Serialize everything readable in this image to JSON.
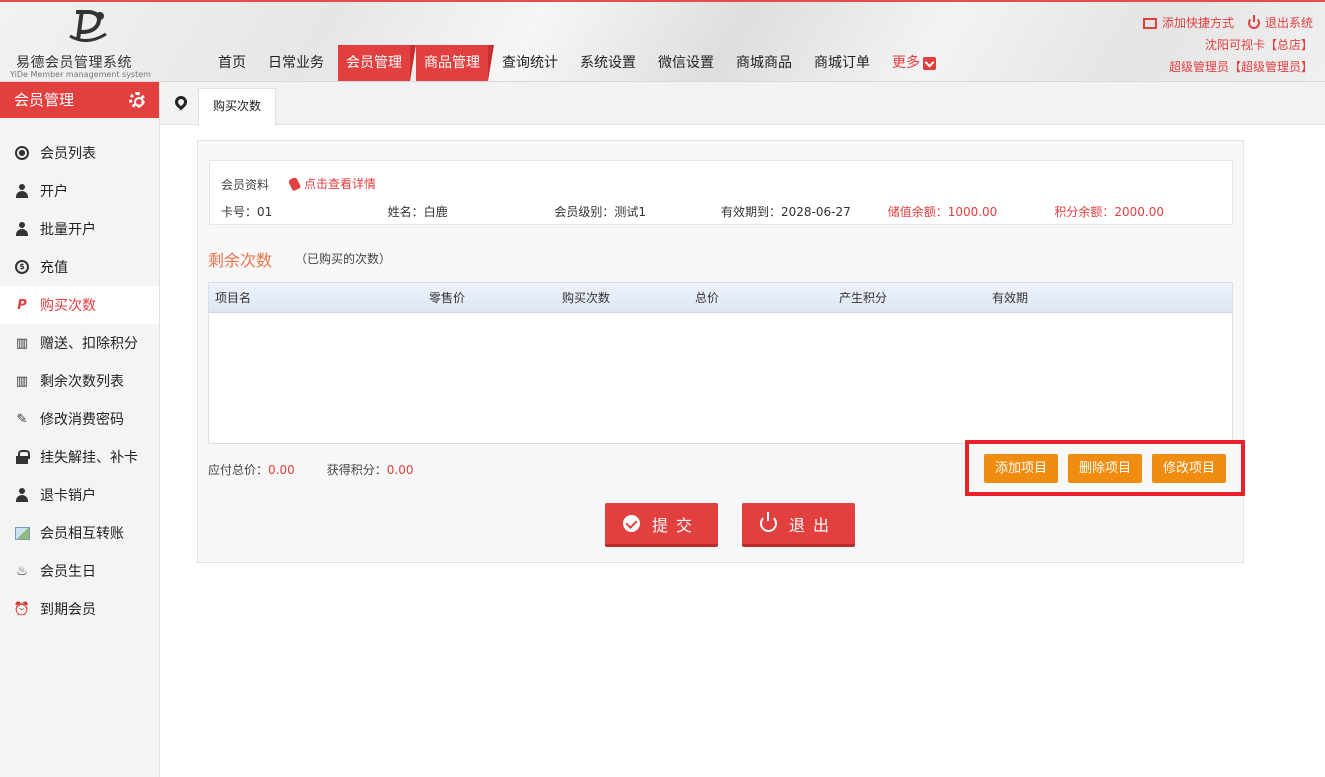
{
  "app": {
    "logo_title": "易德会员管理系统",
    "logo_subtitle": "YiDe Member management system"
  },
  "nav": {
    "items": [
      {
        "label": "首页"
      },
      {
        "label": "日常业务"
      },
      {
        "label": "会员管理"
      },
      {
        "label": "商品管理"
      },
      {
        "label": "查询统计"
      },
      {
        "label": "系统设置"
      },
      {
        "label": "微信设置"
      },
      {
        "label": "商城商品"
      },
      {
        "label": "商城订单"
      }
    ],
    "more_label": "更多"
  },
  "topright": {
    "add_shortcut": "添加快捷方式",
    "logout": "退出系统",
    "store": "沈阳可视卡【总店】",
    "user": "超级管理员【超级管理员】"
  },
  "sidebar": {
    "title": "会员管理",
    "items": [
      {
        "label": "会员列表",
        "icon": "user-circle-icon"
      },
      {
        "label": "开户",
        "icon": "user-icon"
      },
      {
        "label": "批量开户",
        "icon": "user-icon"
      },
      {
        "label": "充值",
        "icon": "dollar-circle-icon"
      },
      {
        "label": "购买次数",
        "icon": "paypal-icon"
      },
      {
        "label": "赠送、扣除积分",
        "icon": "map-icon"
      },
      {
        "label": "剩余次数列表",
        "icon": "map-icon"
      },
      {
        "label": "修改消费密码",
        "icon": "pencil-icon"
      },
      {
        "label": "挂失解挂、补卡",
        "icon": "lock-icon"
      },
      {
        "label": "退卡销户",
        "icon": "user-icon"
      },
      {
        "label": "会员相互转账",
        "icon": "image-icon"
      },
      {
        "label": "会员生日",
        "icon": "cake-icon"
      },
      {
        "label": "到期会员",
        "icon": "alarm-clock-icon"
      }
    ]
  },
  "tabs": {
    "active": "购买次数"
  },
  "member": {
    "section_label": "会员资料",
    "detail_link": "点击查看详情",
    "card_no": "卡号：01",
    "name": "姓名：白鹿",
    "level": "会员级别：测试1",
    "expiry": "有效期到：2028-06-27",
    "balance": "储值余额：1000.00",
    "points": "积分余额：2000.00"
  },
  "remaining": {
    "title": "剩余次数",
    "subtitle": "（已购买的次数）"
  },
  "table": {
    "columns": [
      "项目名",
      "零售价",
      "购买次数",
      "总价",
      "产生积分",
      "有效期"
    ],
    "rows": []
  },
  "totals": {
    "payable_label": "应付总价：",
    "payable_value": "0.00",
    "points_label": "获得积分：",
    "points_value": "0.00"
  },
  "actions": {
    "add": "添加项目",
    "delete": "删除项目",
    "edit": "修改项目",
    "submit": "提交",
    "exit": "退出"
  },
  "colors": {
    "accent": "#e23f3f",
    "orange": "#f08c0f",
    "highlight_border": "#e8222a"
  }
}
